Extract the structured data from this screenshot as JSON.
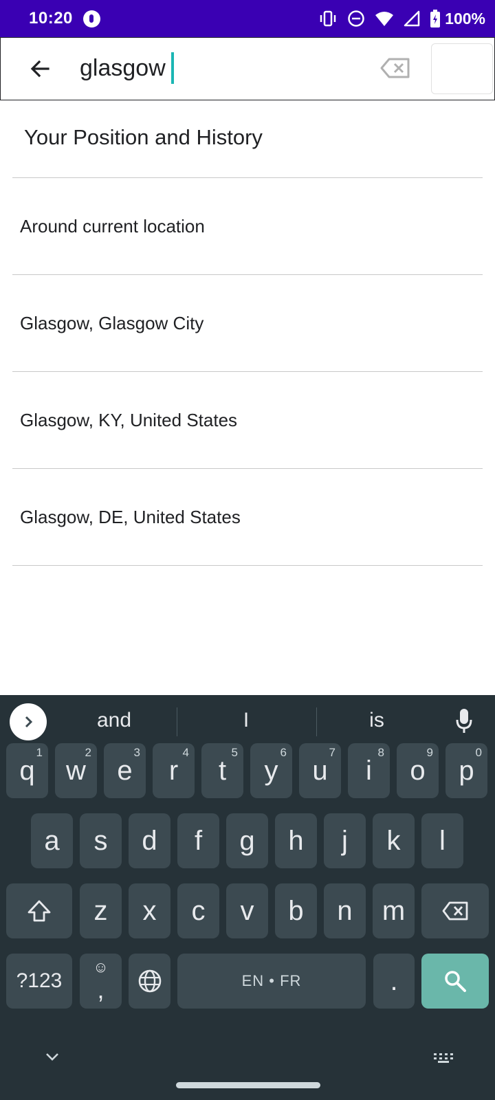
{
  "status_bar": {
    "time": "10:20",
    "battery": "100%",
    "icons": [
      "app-notification-icon",
      "vibrate-icon",
      "do-not-disturb-icon",
      "wifi-icon",
      "cell-signal-icon",
      "battery-icon"
    ]
  },
  "search": {
    "value": "glasgow",
    "back_icon": "arrow-left-icon",
    "clear_icon": "backspace-clear-icon"
  },
  "results": {
    "section_title": "Your Position and History",
    "items": [
      {
        "label": "Around current location"
      },
      {
        "label": "Glasgow, Glasgow City"
      },
      {
        "label": "Glasgow, KY, United States"
      },
      {
        "label": "Glasgow, DE, United States"
      }
    ]
  },
  "keyboard": {
    "suggestions": [
      "and",
      "I",
      "is"
    ],
    "row1": [
      {
        "key": "q",
        "hint": "1"
      },
      {
        "key": "w",
        "hint": "2"
      },
      {
        "key": "e",
        "hint": "3"
      },
      {
        "key": "r",
        "hint": "4"
      },
      {
        "key": "t",
        "hint": "5"
      },
      {
        "key": "y",
        "hint": "6"
      },
      {
        "key": "u",
        "hint": "7"
      },
      {
        "key": "i",
        "hint": "8"
      },
      {
        "key": "o",
        "hint": "9"
      },
      {
        "key": "p",
        "hint": "0"
      }
    ],
    "row2": [
      "a",
      "s",
      "d",
      "f",
      "g",
      "h",
      "j",
      "k",
      "l"
    ],
    "row3": [
      "z",
      "x",
      "c",
      "v",
      "b",
      "n",
      "m"
    ],
    "symbols_label": "?123",
    "comma_label": ",",
    "space_label": "EN • FR",
    "period_label": ".",
    "accent_color": "#6ab7aa"
  }
}
